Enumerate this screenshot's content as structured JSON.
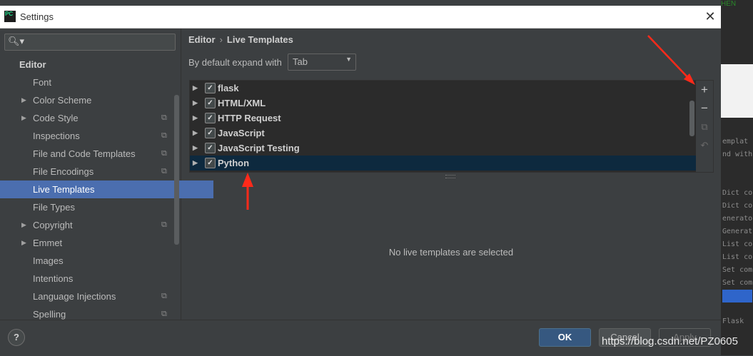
{
  "window": {
    "title": "Settings"
  },
  "search": {
    "placeholder": ""
  },
  "sidebar": {
    "section": "Editor",
    "items": [
      {
        "label": "Font",
        "expandable": false,
        "has_copy": false
      },
      {
        "label": "Color Scheme",
        "expandable": true,
        "has_copy": false
      },
      {
        "label": "Code Style",
        "expandable": true,
        "has_copy": true
      },
      {
        "label": "Inspections",
        "expandable": false,
        "has_copy": true
      },
      {
        "label": "File and Code Templates",
        "expandable": false,
        "has_copy": true
      },
      {
        "label": "File Encodings",
        "expandable": false,
        "has_copy": true
      },
      {
        "label": "Live Templates",
        "expandable": false,
        "has_copy": false,
        "selected": true
      },
      {
        "label": "File Types",
        "expandable": false,
        "has_copy": false
      },
      {
        "label": "Copyright",
        "expandable": true,
        "has_copy": true
      },
      {
        "label": "Emmet",
        "expandable": true,
        "has_copy": false
      },
      {
        "label": "Images",
        "expandable": false,
        "has_copy": false
      },
      {
        "label": "Intentions",
        "expandable": false,
        "has_copy": false
      },
      {
        "label": "Language Injections",
        "expandable": false,
        "has_copy": true
      },
      {
        "label": "Spelling",
        "expandable": false,
        "has_copy": true
      }
    ]
  },
  "breadcrumb": {
    "parent": "Editor",
    "separator": "›",
    "current": "Live Templates"
  },
  "expand": {
    "label": "By default expand with",
    "value": "Tab"
  },
  "template_groups": [
    {
      "label": "flask",
      "checked": true
    },
    {
      "label": "HTML/XML",
      "checked": true
    },
    {
      "label": "HTTP Request",
      "checked": true
    },
    {
      "label": "JavaScript",
      "checked": true
    },
    {
      "label": "JavaScript Testing",
      "checked": true
    },
    {
      "label": "Python",
      "checked": true,
      "selected": true
    }
  ],
  "tools": {
    "add": "+",
    "remove": "−",
    "copy": "⧉",
    "restore": "↶"
  },
  "empty_message": "No live templates are selected",
  "buttons": {
    "help": "?",
    "ok": "OK",
    "cancel": "Cancel",
    "apply": "Apply"
  },
  "watermark": "https://blog.csdn.net/PZ0605",
  "background": {
    "top_text": "HEN",
    "code_lines": [
      "emplat",
      "nd with",
      "",
      "",
      "Dict co",
      "Dict co",
      "enerato",
      "Generat",
      "List co",
      "List co",
      "Set com",
      "Set com",
      "",
      "",
      "Flask"
    ]
  },
  "colors": {
    "accent": "#4b6eaf",
    "selected_row": "#0d293e",
    "ok_button": "#365880",
    "annotation": "#ff2a1a"
  }
}
